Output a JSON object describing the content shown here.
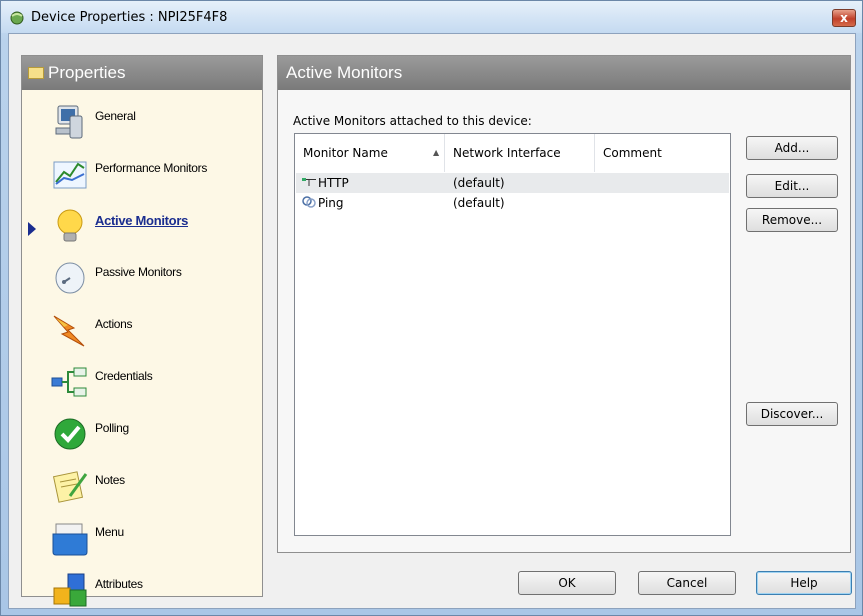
{
  "window": {
    "title": "Device Properties : NPI25F4F8",
    "close_label": "x"
  },
  "sidebar": {
    "header": "Properties",
    "items": [
      {
        "label": "General",
        "icon": "computer-icon"
      },
      {
        "label": "Performance Monitors",
        "icon": "chart-icon"
      },
      {
        "label": "Active Monitors",
        "icon": "lightbulb-icon",
        "active": true
      },
      {
        "label": "Passive Monitors",
        "icon": "satellite-dish-icon"
      },
      {
        "label": "Actions",
        "icon": "lightning-icon"
      },
      {
        "label": "Credentials",
        "icon": "network-icon"
      },
      {
        "label": "Polling",
        "icon": "checkmark-icon"
      },
      {
        "label": "Notes",
        "icon": "notepad-icon"
      },
      {
        "label": "Menu",
        "icon": "menu-folder-icon"
      },
      {
        "label": "Attributes",
        "icon": "cubes-icon"
      }
    ]
  },
  "main": {
    "header": "Active Monitors",
    "subtitle": "Active Monitors attached to this device:",
    "columns": [
      "Monitor Name",
      "Network Interface",
      "Comment"
    ],
    "rows": [
      {
        "name": "HTTP",
        "interface": "(default)",
        "comment": "",
        "icon": "http-monitor-icon"
      },
      {
        "name": "Ping",
        "interface": "(default)",
        "comment": "",
        "icon": "ping-monitor-icon"
      }
    ]
  },
  "buttons": {
    "add": "Add...",
    "edit": "Edit...",
    "remove": "Remove...",
    "discover": "Discover...",
    "ok": "OK",
    "cancel": "Cancel",
    "help": "Help"
  }
}
